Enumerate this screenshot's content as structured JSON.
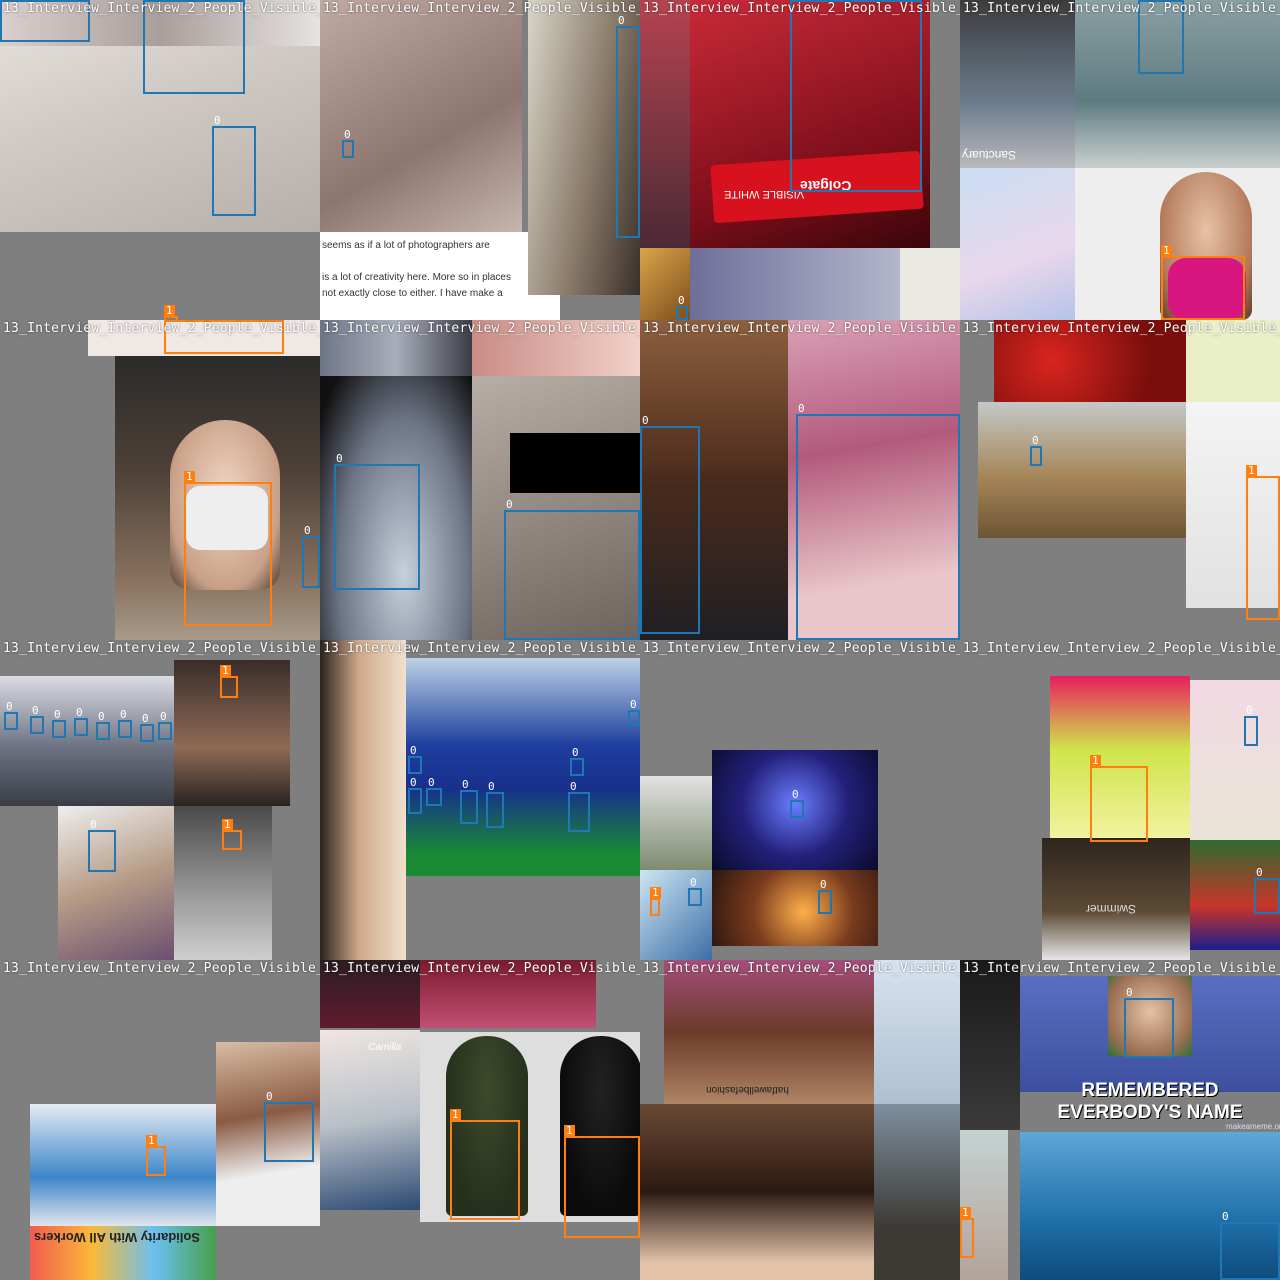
{
  "mosaic": {
    "tile_label": "13_Interview_Interview_2_People_Visible_",
    "class_colors": {
      "0": "#1f77b4",
      "1": "#ff7f0e"
    },
    "class_ids": {
      "face": "0",
      "mask": "1"
    }
  },
  "tile_text": {
    "t02_snippet_1": "seems as if a lot of photographers are",
    "t02_snippet_2": "is a lot of creativity here. More so in places",
    "t02_snippet_3": "not exactly close to either. I have make a",
    "t03_brand": "Colgate",
    "t03_product": "VISIBLE WHITE",
    "t04_sign": "Sanctuary",
    "t15_banner": "Solidarity With All Workers",
    "t16_caption": "Camilla",
    "t17_caption": "hatfawellbefashion",
    "t18_meme": "REMEMBERED EVERBODY'S NAME",
    "t18_site": "makeameme.org",
    "t12_swimmer": "Swimmer"
  }
}
